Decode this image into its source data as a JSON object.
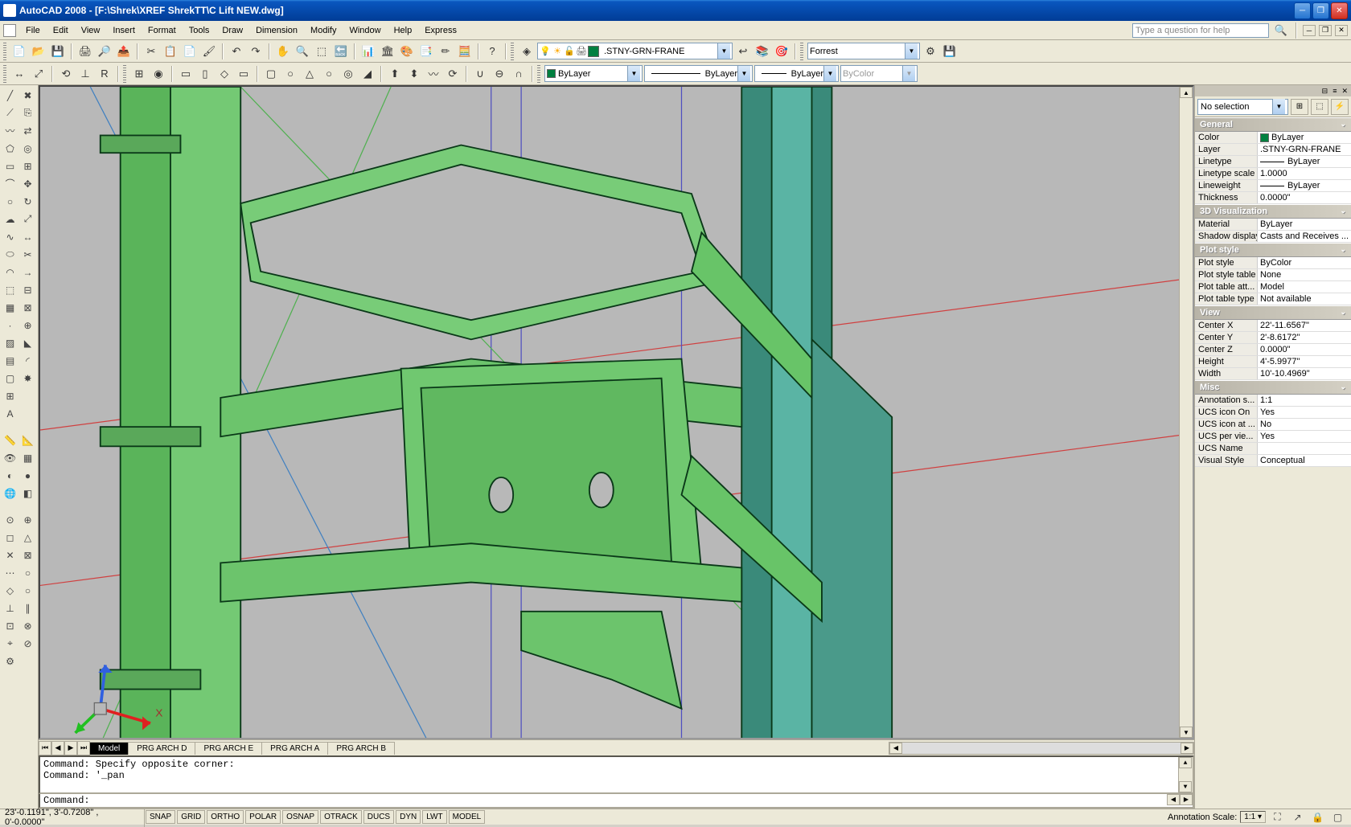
{
  "window": {
    "title": "AutoCAD 2008 - [F:\\Shrek\\XREF ShrekTT\\C Lift NEW.dwg]"
  },
  "menu": {
    "items": [
      "File",
      "Edit",
      "View",
      "Insert",
      "Format",
      "Tools",
      "Draw",
      "Dimension",
      "Modify",
      "Window",
      "Help",
      "Express"
    ],
    "help_placeholder": "Type a question for help"
  },
  "toolbar1": {
    "layer_name": ".STNY-GRN-FRANE",
    "visualstyle": "Forrest"
  },
  "toolbar2": {
    "color": "ByLayer",
    "linetype": "ByLayer",
    "lineweight": "ByLayer",
    "plotstyle": "ByColor"
  },
  "layout": {
    "tabs": [
      "Model",
      "PRG ARCH D",
      "PRG ARCH E",
      "PRG ARCH A",
      "PRG ARCH B"
    ],
    "active": "Model"
  },
  "command": {
    "line1": "Command: Specify opposite corner:",
    "line2": "Command: '_pan",
    "prompt": "Command:"
  },
  "properties": {
    "selection": "No selection",
    "sections": {
      "general": {
        "title": "General",
        "color_swatch": "#008040",
        "color": "ByLayer",
        "layer": ".STNY-GRN-FRANE",
        "linetype": "ByLayer",
        "linetype_scale": "1.0000",
        "lineweight": "ByLayer",
        "thickness": "0.0000\""
      },
      "viz": {
        "title": "3D Visualization",
        "material": "ByLayer",
        "shadow": "Casts and Receives ..."
      },
      "plot": {
        "title": "Plot style",
        "style": "ByColor",
        "table": "None",
        "table_att": "Model",
        "table_type": "Not available"
      },
      "view": {
        "title": "View",
        "center_x": "22'-11.6567\"",
        "center_y": "2'-8.6172\"",
        "center_z": "0.0000\"",
        "height": "4'-5.9977\"",
        "width": "10'-10.4969\""
      },
      "misc": {
        "title": "Misc",
        "anno_scale": "1:1",
        "ucs_icon_on": "Yes",
        "ucs_icon_at": "No",
        "ucs_per_view": "Yes",
        "ucs_name": "",
        "visual_style": "Conceptual"
      }
    }
  },
  "status": {
    "coords": "23'-0.1191\", 3'-0.7208\" , 0'-0.0000\"",
    "toggles": [
      "SNAP",
      "GRID",
      "ORTHO",
      "POLAR",
      "OSNAP",
      "OTRACK",
      "DUCS",
      "DYN",
      "LWT",
      "MODEL"
    ],
    "anno_label": "Annotation Scale:",
    "anno_value": "1:1"
  }
}
